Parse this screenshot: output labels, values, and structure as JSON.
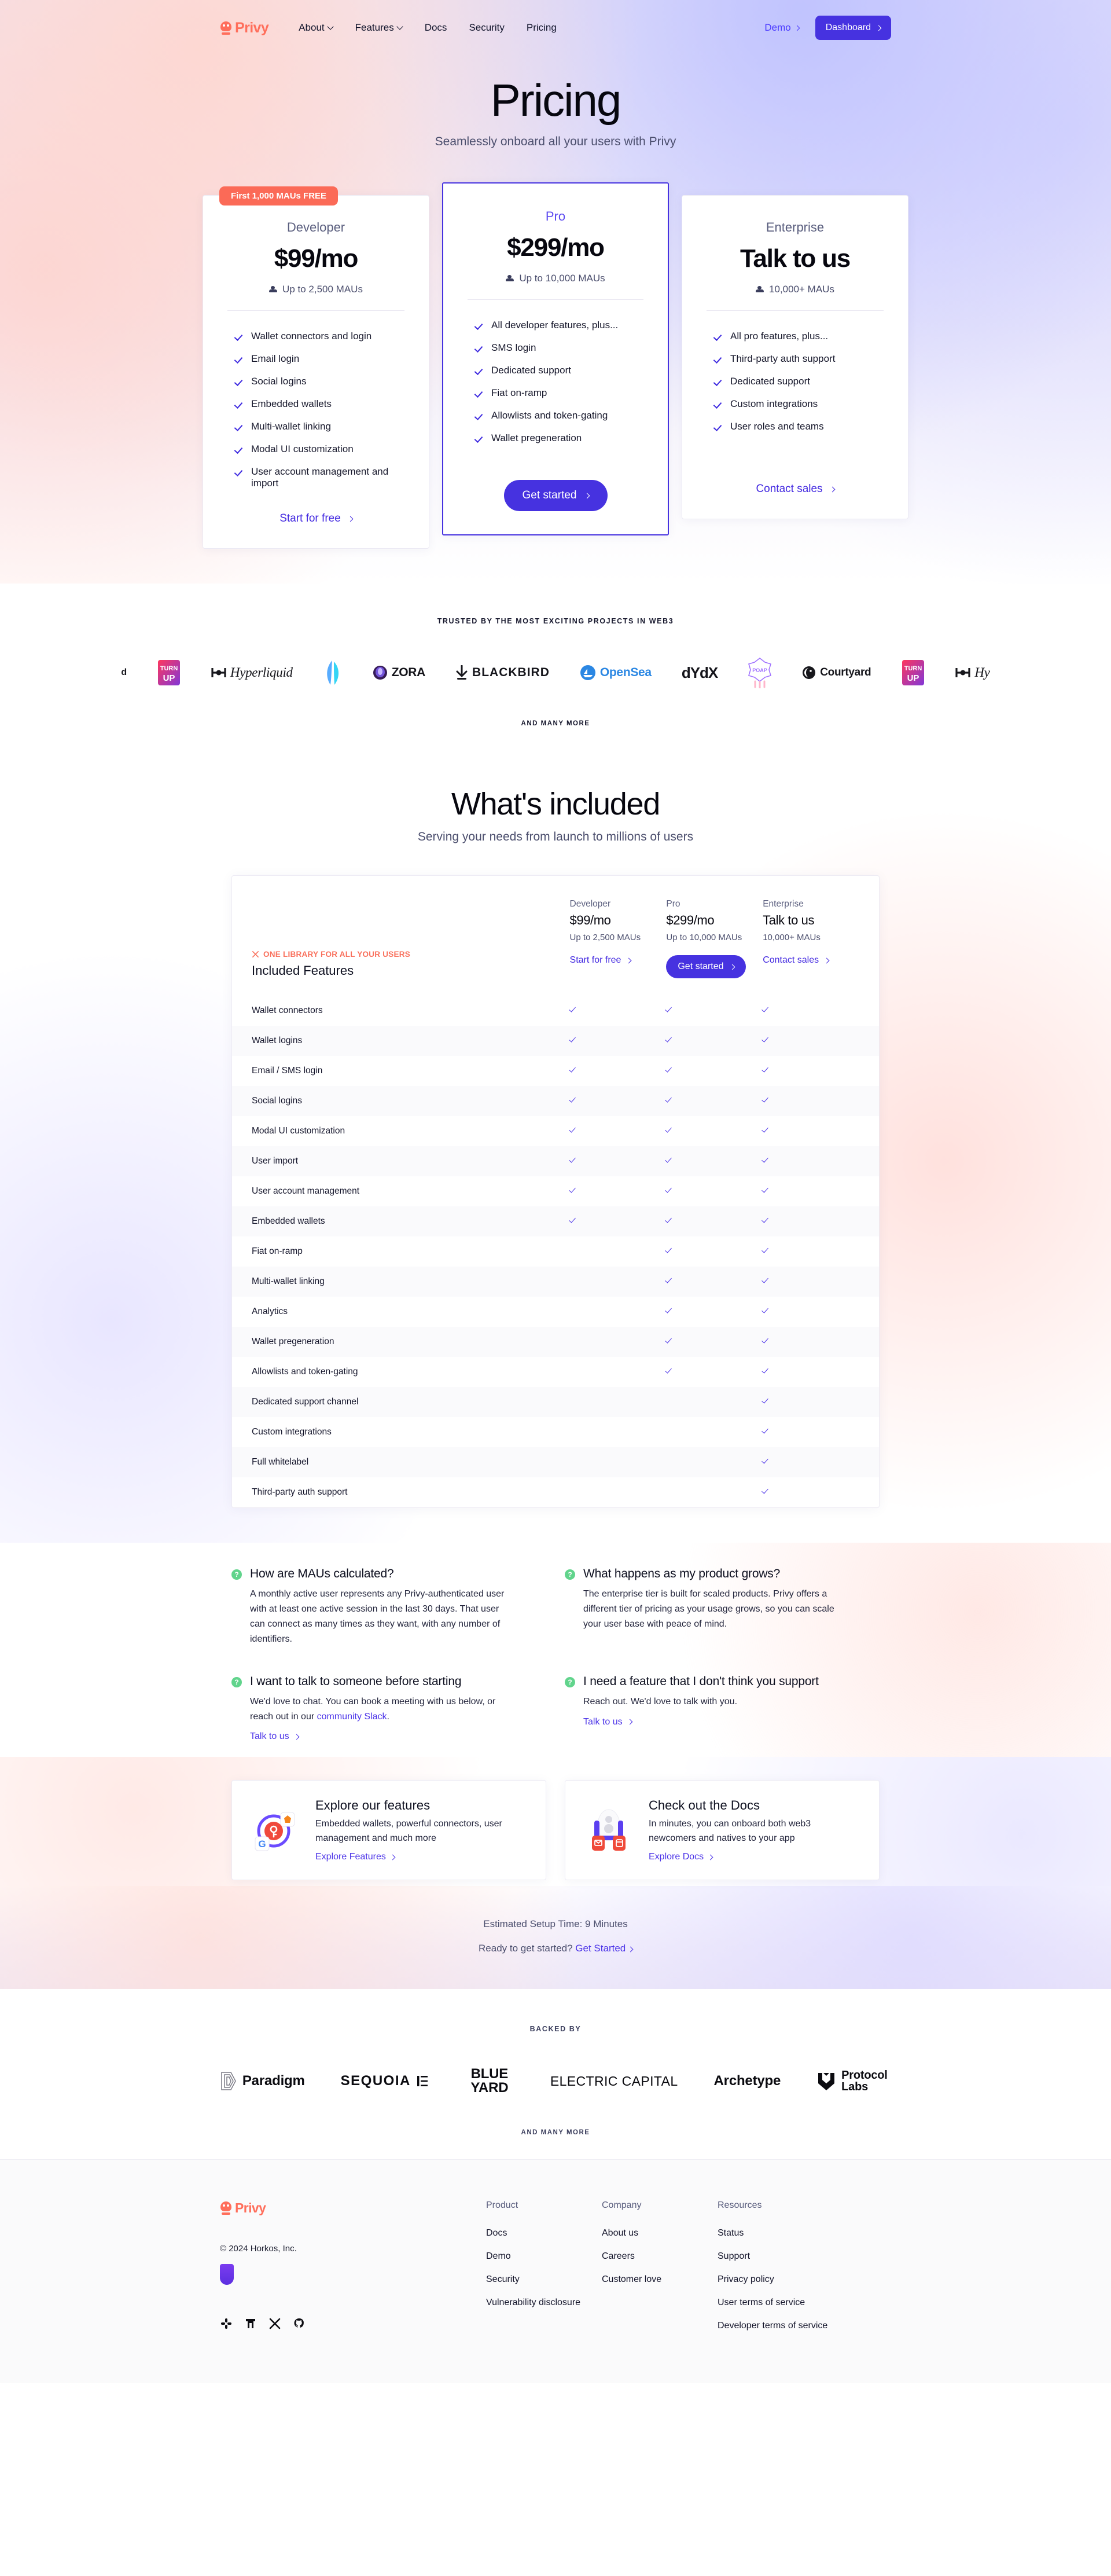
{
  "nav": {
    "brand": "Privy",
    "links": [
      {
        "label": "About",
        "caret": true
      },
      {
        "label": "Features",
        "caret": true
      },
      {
        "label": "Docs",
        "caret": false
      },
      {
        "label": "Security",
        "caret": false
      },
      {
        "label": "Pricing",
        "caret": false
      }
    ],
    "demo_label": "Demo",
    "dashboard_label": "Dashboard"
  },
  "hero": {
    "title": "Pricing",
    "subtitle": "Seamlessly onboard all your users with Privy"
  },
  "plans": [
    {
      "badge": "First 1,000 MAUs FREE",
      "name": "Developer",
      "price": "$99/mo",
      "maus": "Up to 2,500 MAUs",
      "features": [
        "Wallet connectors and login",
        "Email login",
        "Social logins",
        "Embedded wallets",
        "Multi-wallet linking",
        "Modal UI customization",
        "User account management and import"
      ],
      "cta": "Start for free",
      "cta_style": "text"
    },
    {
      "badge": "",
      "name": "Pro",
      "price": "$299/mo",
      "maus": "Up to 10,000 MAUs",
      "features": [
        "All developer features, plus...",
        "SMS login",
        "Dedicated support",
        "Fiat on-ramp",
        "Allowlists and token-gating",
        "Wallet pregeneration"
      ],
      "cta": "Get started",
      "cta_style": "solid"
    },
    {
      "badge": "",
      "name": "Enterprise",
      "price": "Talk to us",
      "maus": "10,000+ MAUs",
      "features": [
        "All pro features, plus...",
        "Third-party auth support",
        "Dedicated support",
        "Custom integrations",
        "User roles and teams"
      ],
      "cta": "Contact sales",
      "cta_style": "text"
    }
  ],
  "trusted": {
    "eyebrow": "TRUSTED BY THE MOST EXCITING PROJECTS IN WEB3",
    "and_many_more": "AND MANY MORE",
    "logos": [
      {
        "name": "d",
        "kind": "partial"
      },
      {
        "name": "TURN UP",
        "kind": "turnup"
      },
      {
        "name": "Hyperliquid",
        "kind": "serif"
      },
      {
        "name": "",
        "kind": "blueblob"
      },
      {
        "name": "ZORA",
        "kind": "zora"
      },
      {
        "name": "BLACKBIRD",
        "kind": "blackbird"
      },
      {
        "name": "OpenSea",
        "kind": "opensea"
      },
      {
        "name": "dYdX",
        "kind": "dydx"
      },
      {
        "name": "POAP",
        "kind": "poap"
      },
      {
        "name": "Courtyard",
        "kind": "courtyard"
      },
      {
        "name": "TURN UP",
        "kind": "turnup"
      },
      {
        "name": "Hy",
        "kind": "serif-partial"
      }
    ]
  },
  "included": {
    "title": "What's included",
    "subtitle": "Serving your needs from launch to millions of users",
    "library_tag": "ONE LIBRARY FOR ALL YOUR USERS",
    "features_heading": "Included Features",
    "columns": [
      {
        "tier": "Developer",
        "price": "$99/mo",
        "maus": "Up to 2,500 MAUs",
        "cta": "Start for free",
        "cta_style": "text"
      },
      {
        "tier": "Pro",
        "price": "$299/mo",
        "maus": "Up to 10,000 MAUs",
        "cta": "Get started",
        "cta_style": "solid"
      },
      {
        "tier": "Enterprise",
        "price": "Talk to us",
        "maus": "10,000+ MAUs",
        "cta": "Contact sales",
        "cta_style": "text"
      }
    ],
    "rows": [
      {
        "feature": "Wallet connectors",
        "developer": true,
        "pro": true,
        "enterprise": true
      },
      {
        "feature": "Wallet logins",
        "developer": true,
        "pro": true,
        "enterprise": true
      },
      {
        "feature": "Email / SMS login",
        "developer": true,
        "pro": true,
        "enterprise": true
      },
      {
        "feature": "Social logins",
        "developer": true,
        "pro": true,
        "enterprise": true
      },
      {
        "feature": "Modal UI customization",
        "developer": true,
        "pro": true,
        "enterprise": true
      },
      {
        "feature": "User import",
        "developer": true,
        "pro": true,
        "enterprise": true
      },
      {
        "feature": "User account management",
        "developer": true,
        "pro": true,
        "enterprise": true
      },
      {
        "feature": "Embedded wallets",
        "developer": true,
        "pro": true,
        "enterprise": true
      },
      {
        "feature": "Fiat on-ramp",
        "developer": false,
        "pro": true,
        "enterprise": true
      },
      {
        "feature": "Multi-wallet linking",
        "developer": false,
        "pro": true,
        "enterprise": true
      },
      {
        "feature": "Analytics",
        "developer": false,
        "pro": true,
        "enterprise": true
      },
      {
        "feature": "Wallet pregeneration",
        "developer": false,
        "pro": true,
        "enterprise": true
      },
      {
        "feature": "Allowlists and token-gating",
        "developer": false,
        "pro": true,
        "enterprise": true
      },
      {
        "feature": "Dedicated support channel",
        "developer": false,
        "pro": false,
        "enterprise": true
      },
      {
        "feature": "Custom integrations",
        "developer": false,
        "pro": false,
        "enterprise": true
      },
      {
        "feature": "Full whitelabel",
        "developer": false,
        "pro": false,
        "enterprise": true
      },
      {
        "feature": "Third-party auth support",
        "developer": false,
        "pro": false,
        "enterprise": true
      }
    ]
  },
  "faq": [
    {
      "question": "How are MAUs calculated?",
      "answer": "A monthly active user represents any Privy-authenticated user with at least one active session in the last 30 days. That user can connect as many times as they want, with any number of identifiers.",
      "link_text": "",
      "cta": ""
    },
    {
      "question": "What happens as my product grows?",
      "answer": "The enterprise tier is built for scaled products. Privy offers a different tier of pricing as your usage grows, so you can scale your user base with peace of mind.",
      "link_text": "",
      "cta": ""
    },
    {
      "question": "I want to talk to someone before starting",
      "answer_pre": "We'd love to chat. You can book a meeting with us below, or reach out in our ",
      "answer_link": "community Slack",
      "answer_post": ".",
      "cta": "Talk to us"
    },
    {
      "question": "I need a feature that I don't think you support",
      "answer": "Reach out. We'd love to talk with you.",
      "cta": "Talk to us"
    }
  ],
  "promos": [
    {
      "heading": "Explore our features",
      "body": "Embedded wallets, powerful connectors, user management and much more",
      "link": "Explore Features"
    },
    {
      "heading": "Check out the Docs",
      "body": "In minutes, you can onboard both web3 newcomers and natives to your app",
      "link": "Explore Docs"
    }
  ],
  "setup": {
    "estimate": "Estimated Setup Time: 9 Minutes",
    "ready_prefix": "Ready to get started?",
    "ready_cta": "Get Started"
  },
  "backed": {
    "eyebrow": "BACKED BY",
    "and_many_more": "AND MANY MORE",
    "investors": [
      {
        "name": "Paradigm",
        "kind": "paradigm"
      },
      {
        "name": "SEQUOIA",
        "kind": "sequoia"
      },
      {
        "name": "BLUE YARD",
        "kind": "blueyard"
      },
      {
        "name": "ELECTRIC CAPITAL",
        "kind": "electric"
      },
      {
        "name": "Archetype",
        "kind": "archetype"
      },
      {
        "name": "Protocol Labs",
        "kind": "protocol"
      }
    ]
  },
  "footer": {
    "brand": "Privy",
    "copyright": "© 2024 Horkos, Inc.",
    "socials": [
      "slack-icon",
      "farcaster-icon",
      "x-icon",
      "github-icon"
    ],
    "columns": [
      {
        "heading": "Product",
        "links": [
          "Docs",
          "Demo",
          "Security",
          "Vulnerability disclosure"
        ]
      },
      {
        "heading": "Company",
        "links": [
          "About us",
          "Careers",
          "Customer love"
        ]
      },
      {
        "heading": "Resources",
        "links": [
          "Status",
          "Support",
          "Privacy policy",
          "User terms of service",
          "Developer terms of service"
        ]
      }
    ]
  },
  "colors": {
    "accent_purple": "#4632e0",
    "accent_coral": "#ff6e5b",
    "green": "#61d48c",
    "text": "#11142b",
    "muted": "#4b4e6d"
  }
}
